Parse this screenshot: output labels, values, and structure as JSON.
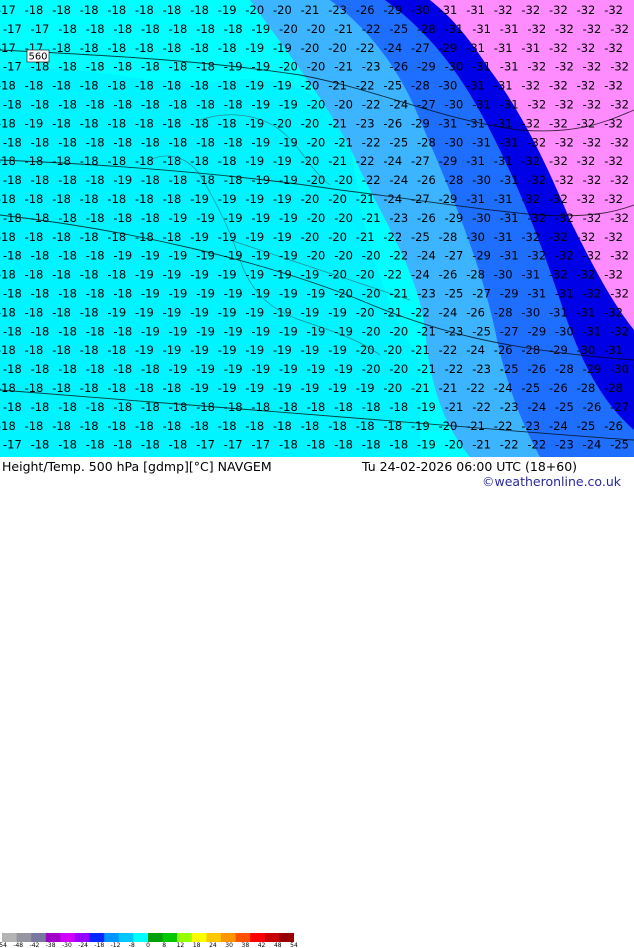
{
  "footer": {
    "title": "Height/Temp. 500 hPa [gdmp][°C] NAVGEM",
    "valid": "Tu 24-02-2026 06:00 UTC (18+60)",
    "credit": "©weatheronline.co.uk"
  },
  "contour_label": "560",
  "colorbar": {
    "ticks": [
      "-54",
      "-48",
      "-42",
      "-38",
      "-30",
      "-24",
      "-18",
      "-12",
      "-8",
      "0",
      "8",
      "12",
      "18",
      "24",
      "30",
      "38",
      "42",
      "48",
      "54"
    ],
    "colors": [
      "#b4b4b4",
      "#9696a0",
      "#7878a0",
      "#a000c8",
      "#d200ff",
      "#9600ff",
      "#0028ff",
      "#0096ff",
      "#00c8ff",
      "#00ffff",
      "#00a000",
      "#00c800",
      "#96ff00",
      "#ffff00",
      "#ffc800",
      "#ff9600",
      "#ff5000",
      "#ff0000",
      "#c80000",
      "#960000"
    ]
  },
  "colors": {
    "cold_extreme": "#ff8cff",
    "very_cold": "#0000e6",
    "cold": "#1e6eff",
    "cool": "#3cb4ff",
    "mild": "#00e6ff",
    "background": "#00ffff"
  },
  "temperature_rows": [
    [
      "-17",
      "-18",
      "-18",
      "-18",
      "-18",
      "-18",
      "-18",
      "-18",
      "-19",
      "-20",
      "-20",
      "-21",
      "-23",
      "-26",
      "-29",
      "-30",
      "-31",
      "-31",
      "-32",
      "-32",
      "-32",
      "-32",
      "-32"
    ],
    [
      "-17",
      "-17",
      "-18",
      "-18",
      "-18",
      "-18",
      "-18",
      "-18",
      "-18",
      "-19",
      "-20",
      "-20",
      "-21",
      "-22",
      "-25",
      "-28",
      "-31",
      "-31",
      "-31",
      "-32",
      "-32",
      "-32",
      "-32"
    ],
    [
      "-17",
      "-17",
      "-18",
      "-18",
      "-18",
      "-18",
      "-18",
      "-18",
      "-18",
      "-19",
      "-19",
      "-20",
      "-20",
      "-22",
      "-24",
      "-27",
      "-29",
      "-31",
      "-31",
      "-31",
      "-32",
      "-32",
      "-32"
    ],
    [
      "-17",
      "-18",
      "-18",
      "-18",
      "-18",
      "-18",
      "-18",
      "-18",
      "-19",
      "-19",
      "-20",
      "-20",
      "-21",
      "-23",
      "-26",
      "-29",
      "-30",
      "-31",
      "-31",
      "-32",
      "-32",
      "-32",
      "-32"
    ],
    [
      "-18",
      "-18",
      "-18",
      "-18",
      "-18",
      "-18",
      "-18",
      "-18",
      "-18",
      "-19",
      "-19",
      "-20",
      "-21",
      "-22",
      "-25",
      "-28",
      "-30",
      "-31",
      "-31",
      "-32",
      "-32",
      "-32",
      "-32"
    ],
    [
      "-18",
      "-18",
      "-18",
      "-18",
      "-18",
      "-18",
      "-18",
      "-18",
      "-18",
      "-19",
      "-19",
      "-20",
      "-20",
      "-22",
      "-24",
      "-27",
      "-30",
      "-31",
      "-31",
      "-32",
      "-32",
      "-32",
      "-32"
    ],
    [
      "-18",
      "-19",
      "-18",
      "-18",
      "-18",
      "-18",
      "-18",
      "-18",
      "-18",
      "-19",
      "-20",
      "-20",
      "-21",
      "-23",
      "-26",
      "-29",
      "-31",
      "-31",
      "-31",
      "-32",
      "-32",
      "-32",
      "-32"
    ],
    [
      "-18",
      "-18",
      "-18",
      "-18",
      "-18",
      "-18",
      "-18",
      "-18",
      "-18",
      "-19",
      "-19",
      "-20",
      "-21",
      "-22",
      "-25",
      "-28",
      "-30",
      "-31",
      "-31",
      "-32",
      "-32",
      "-32",
      "-32"
    ],
    [
      "-18",
      "-18",
      "-18",
      "-18",
      "-18",
      "-18",
      "-18",
      "-18",
      "-18",
      "-19",
      "-19",
      "-20",
      "-21",
      "-22",
      "-24",
      "-27",
      "-29",
      "-31",
      "-31",
      "-32",
      "-32",
      "-32",
      "-32"
    ],
    [
      "-18",
      "-18",
      "-18",
      "-18",
      "-19",
      "-18",
      "-18",
      "-18",
      "-18",
      "-19",
      "-19",
      "-20",
      "-20",
      "-22",
      "-24",
      "-26",
      "-28",
      "-30",
      "-31",
      "-32",
      "-32",
      "-32",
      "-32"
    ],
    [
      "-18",
      "-18",
      "-18",
      "-18",
      "-18",
      "-18",
      "-18",
      "-19",
      "-19",
      "-19",
      "-19",
      "-20",
      "-20",
      "-21",
      "-24",
      "-27",
      "-29",
      "-31",
      "-31",
      "-32",
      "-32",
      "-32",
      "-32"
    ],
    [
      "-18",
      "-18",
      "-18",
      "-18",
      "-18",
      "-18",
      "-19",
      "-19",
      "-19",
      "-19",
      "-19",
      "-20",
      "-20",
      "-21",
      "-23",
      "-26",
      "-29",
      "-30",
      "-31",
      "-32",
      "-32",
      "-32",
      "-32"
    ],
    [
      "-18",
      "-18",
      "-18",
      "-18",
      "-18",
      "-18",
      "-18",
      "-19",
      "-19",
      "-19",
      "-19",
      "-20",
      "-20",
      "-21",
      "-22",
      "-25",
      "-28",
      "-30",
      "-31",
      "-32",
      "-32",
      "-32",
      "-32"
    ],
    [
      "-18",
      "-18",
      "-18",
      "-18",
      "-19",
      "-19",
      "-19",
      "-19",
      "-19",
      "-19",
      "-19",
      "-20",
      "-20",
      "-20",
      "-22",
      "-24",
      "-27",
      "-29",
      "-31",
      "-32",
      "-32",
      "-32",
      "-32"
    ],
    [
      "-18",
      "-18",
      "-18",
      "-18",
      "-18",
      "-19",
      "-19",
      "-19",
      "-19",
      "-19",
      "-19",
      "-19",
      "-20",
      "-20",
      "-22",
      "-24",
      "-26",
      "-28",
      "-30",
      "-31",
      "-32",
      "-32",
      "-32"
    ],
    [
      "-18",
      "-18",
      "-18",
      "-18",
      "-18",
      "-19",
      "-19",
      "-19",
      "-19",
      "-19",
      "-19",
      "-19",
      "-20",
      "-20",
      "-21",
      "-23",
      "-25",
      "-27",
      "-29",
      "-31",
      "-31",
      "-32",
      "-32"
    ],
    [
      "-18",
      "-18",
      "-18",
      "-18",
      "-19",
      "-19",
      "-19",
      "-19",
      "-19",
      "-19",
      "-19",
      "-19",
      "-19",
      "-20",
      "-21",
      "-22",
      "-24",
      "-26",
      "-28",
      "-30",
      "-31",
      "-31",
      "-32"
    ],
    [
      "-18",
      "-18",
      "-18",
      "-18",
      "-18",
      "-19",
      "-19",
      "-19",
      "-19",
      "-19",
      "-19",
      "-19",
      "-19",
      "-20",
      "-20",
      "-21",
      "-23",
      "-25",
      "-27",
      "-29",
      "-30",
      "-31",
      "-32"
    ],
    [
      "-18",
      "-18",
      "-18",
      "-18",
      "-18",
      "-19",
      "-19",
      "-19",
      "-19",
      "-19",
      "-19",
      "-19",
      "-19",
      "-20",
      "-20",
      "-21",
      "-22",
      "-24",
      "-26",
      "-28",
      "-29",
      "-30",
      "-31"
    ],
    [
      "-18",
      "-18",
      "-18",
      "-18",
      "-18",
      "-18",
      "-19",
      "-19",
      "-19",
      "-19",
      "-19",
      "-19",
      "-19",
      "-20",
      "-20",
      "-21",
      "-22",
      "-23",
      "-25",
      "-26",
      "-28",
      "-29",
      "-30"
    ],
    [
      "-18",
      "-18",
      "-18",
      "-18",
      "-18",
      "-18",
      "-18",
      "-19",
      "-19",
      "-19",
      "-19",
      "-19",
      "-19",
      "-19",
      "-20",
      "-21",
      "-21",
      "-22",
      "-24",
      "-25",
      "-26",
      "-28",
      "-28"
    ],
    [
      "-18",
      "-18",
      "-18",
      "-18",
      "-18",
      "-18",
      "-18",
      "-18",
      "-18",
      "-18",
      "-18",
      "-18",
      "-18",
      "-18",
      "-18",
      "-19",
      "-21",
      "-22",
      "-23",
      "-24",
      "-25",
      "-26",
      "-27"
    ],
    [
      "-18",
      "-18",
      "-18",
      "-18",
      "-18",
      "-18",
      "-18",
      "-18",
      "-18",
      "-18",
      "-18",
      "-18",
      "-18",
      "-18",
      "-18",
      "-19",
      "-20",
      "-21",
      "-22",
      "-23",
      "-24",
      "-25",
      "-26"
    ],
    [
      "-17",
      "-18",
      "-18",
      "-18",
      "-18",
      "-18",
      "-18",
      "-17",
      "-17",
      "-17",
      "-18",
      "-18",
      "-18",
      "-18",
      "-18",
      "-19",
      "-20",
      "-21",
      "-22",
      "-22",
      "-23",
      "-24",
      "-25"
    ],
    [
      "-17",
      "-17",
      "-18",
      "-18",
      "-18",
      "-18",
      "-17",
      "-17",
      "-17",
      "-17",
      "-17",
      "-17",
      "-18",
      "-18",
      "-18",
      "-18",
      "-19",
      "-20",
      "-21",
      "-22",
      "-23",
      "-23",
      "-24"
    ]
  ]
}
